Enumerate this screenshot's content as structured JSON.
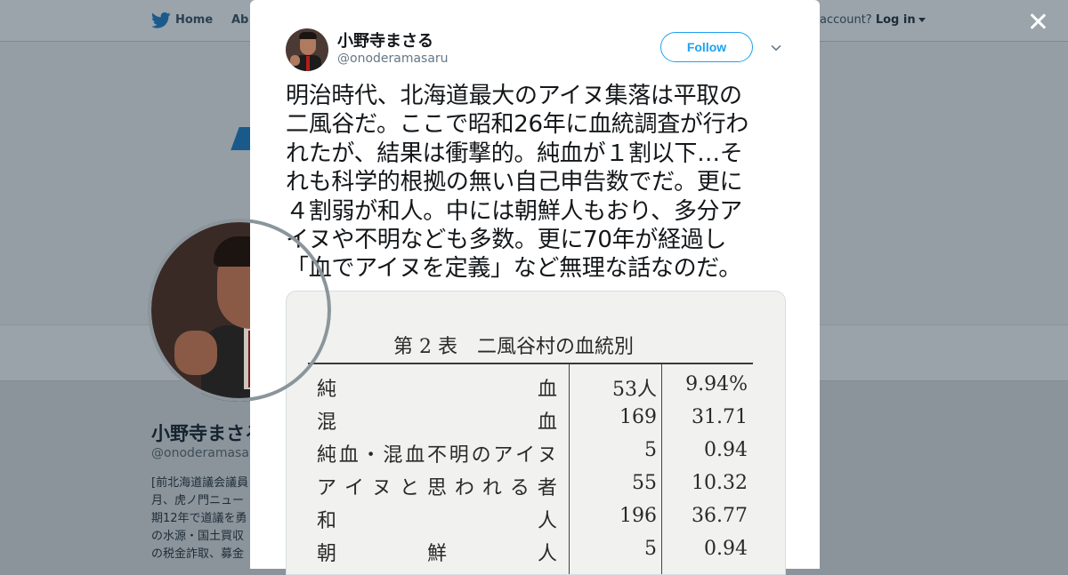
{
  "background": {
    "nav": {
      "home_label": "Home",
      "about_label": "About",
      "account_prompt": "account?",
      "login_label": "Log in"
    },
    "profile": {
      "name": "小野寺まさる",
      "handle": "@onoderamasaru",
      "bio_lines": [
        "[前北海道議会議員",
        "月、虎ノ門ニュー",
        "期12年で道議を勇",
        "の水源・国土買収",
        "の税金詐取、募金"
      ]
    }
  },
  "modal": {
    "close_icon": "close-icon",
    "user": {
      "display_name": "小野寺まさる",
      "screen_name": "@onoderamasaru"
    },
    "follow_label": "Follow",
    "tweet_lines": [
      "明治時代、北海道最大のアイヌ集落は平取の",
      "二風谷だ。ここで昭和26年に血統調査が行わ",
      "れたが、結果は衝撃的。純血が１割以下…そ",
      "れも科学的根拠の無い自己申告数でだ。更に",
      "４割弱が和人。中には朝鮮人もおり、多分ア",
      "イヌや不明なども多数。更に70年が経過し",
      "「血でアイヌを定義」など無理な話なのだ。"
    ],
    "media": {
      "table_label": "第 2 表",
      "table_title": "二風谷村の血統別",
      "rows": [
        {
          "label": "純血",
          "label_style": "spread",
          "parts": [
            "純",
            "血"
          ],
          "count": "53人",
          "percent": "9.94%"
        },
        {
          "label": "混血",
          "label_style": "spread",
          "parts": [
            "混",
            "血"
          ],
          "count": "169",
          "percent": "31.71"
        },
        {
          "label": "純血・混血不明のアイヌ",
          "label_style": "even",
          "parts": [
            "純",
            "血",
            "・",
            "混",
            "血",
            "不",
            "明",
            "の",
            "ア",
            "イ",
            "ヌ"
          ],
          "count": "5",
          "percent": "0.94"
        },
        {
          "label": "アイヌと思われる者",
          "label_style": "even",
          "parts": [
            "ア",
            "イ",
            "ヌ",
            "と",
            "思",
            "わ",
            "れ",
            "る",
            "者"
          ],
          "count": "55",
          "percent": "10.32"
        },
        {
          "label": "和人",
          "label_style": "spread",
          "parts": [
            "和",
            "人"
          ],
          "count": "196",
          "percent": "36.77"
        },
        {
          "label": "朝鮮人",
          "label_style": "spread",
          "parts": [
            "朝",
            "鮮",
            "人"
          ],
          "count": "5",
          "percent": "0.94"
        }
      ]
    }
  }
}
